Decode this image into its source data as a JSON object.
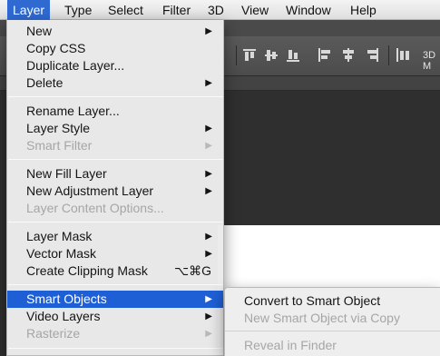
{
  "menubar": {
    "items": [
      "Layer",
      "Type",
      "Select",
      "Filter",
      "3D",
      "View",
      "Window",
      "Help"
    ],
    "active": "Layer"
  },
  "options_bar": {
    "label_3d": "3D M"
  },
  "layer_menu": {
    "items": [
      {
        "label": "New",
        "submenu": true,
        "disabled": false
      },
      {
        "label": "Copy CSS",
        "disabled": false
      },
      {
        "label": "Duplicate Layer...",
        "disabled": false
      },
      {
        "label": "Delete",
        "submenu": true,
        "disabled": false
      },
      {
        "label": "Rename Layer...",
        "disabled": false
      },
      {
        "label": "Layer Style",
        "submenu": true,
        "disabled": false
      },
      {
        "label": "Smart Filter",
        "submenu": true,
        "disabled": true
      },
      {
        "label": "New Fill Layer",
        "submenu": true,
        "disabled": false
      },
      {
        "label": "New Adjustment Layer",
        "submenu": true,
        "disabled": false
      },
      {
        "label": "Layer Content Options...",
        "disabled": true
      },
      {
        "label": "Layer Mask",
        "submenu": true,
        "disabled": false
      },
      {
        "label": "Vector Mask",
        "submenu": true,
        "disabled": false
      },
      {
        "label": "Create Clipping Mask",
        "shortcut": "⌥⌘G",
        "disabled": false
      },
      {
        "label": "Smart Objects",
        "submenu": true,
        "highlighted": true
      },
      {
        "label": "Video Layers",
        "submenu": true,
        "disabled": false
      },
      {
        "label": "Rasterize",
        "submenu": true,
        "disabled": true
      }
    ]
  },
  "smart_objects_submenu": {
    "items": [
      {
        "label": "Convert to Smart Object",
        "disabled": false
      },
      {
        "label": "New Smart Object via Copy",
        "disabled": true
      },
      {
        "label": "Reveal in Finder",
        "disabled": true
      }
    ]
  },
  "colors": {
    "highlight": "#1f5fd6",
    "menubar_active": "#2f6ad3",
    "disabled_text": "#a6a6a6"
  }
}
